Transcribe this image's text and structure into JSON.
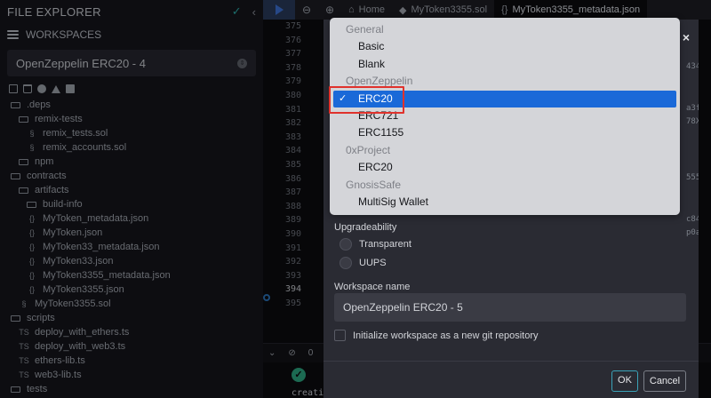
{
  "explorer": {
    "title": "FILE EXPLORER",
    "workspaces_label": "WORKSPACES",
    "workspace_selected": "OpenZeppelin ERC20 - 4",
    "tree": [
      {
        "label": ".deps",
        "kind": "folder",
        "depth": 0
      },
      {
        "label": "remix-tests",
        "kind": "folder",
        "depth": 1
      },
      {
        "label": "remix_tests.sol",
        "kind": "sol",
        "depth": 2
      },
      {
        "label": "remix_accounts.sol",
        "kind": "sol",
        "depth": 2
      },
      {
        "label": "npm",
        "kind": "folder",
        "depth": 1
      },
      {
        "label": "contracts",
        "kind": "folder",
        "depth": 0
      },
      {
        "label": "artifacts",
        "kind": "folder",
        "depth": 1
      },
      {
        "label": "build-info",
        "kind": "folder",
        "depth": 2
      },
      {
        "label": "MyToken_metadata.json",
        "kind": "json",
        "depth": 2
      },
      {
        "label": "MyToken.json",
        "kind": "json",
        "depth": 2
      },
      {
        "label": "MyToken33_metadata.json",
        "kind": "json",
        "depth": 2
      },
      {
        "label": "MyToken33.json",
        "kind": "json",
        "depth": 2
      },
      {
        "label": "MyToken3355_metadata.json",
        "kind": "json",
        "depth": 2
      },
      {
        "label": "MyToken3355.json",
        "kind": "json",
        "depth": 2
      },
      {
        "label": "MyToken3355.sol",
        "kind": "sol",
        "depth": 1
      },
      {
        "label": "scripts",
        "kind": "folder",
        "depth": 0
      },
      {
        "label": "deploy_with_ethers.ts",
        "kind": "ts",
        "depth": 1
      },
      {
        "label": "deploy_with_web3.ts",
        "kind": "ts",
        "depth": 1
      },
      {
        "label": "ethers-lib.ts",
        "kind": "ts",
        "depth": 1
      },
      {
        "label": "web3-lib.ts",
        "kind": "ts",
        "depth": 1
      },
      {
        "label": "tests",
        "kind": "folder",
        "depth": 0
      }
    ]
  },
  "editor": {
    "zoom_out": "⊖",
    "zoom_in": "⊕",
    "tabs": [
      {
        "label": "Home",
        "icon": "home-icon",
        "glyph": "⌂"
      },
      {
        "label": "MyToken3355.sol",
        "icon": "solidity-icon",
        "glyph": "◆"
      },
      {
        "label": "MyToken3355_metadata.json",
        "icon": "json-icon",
        "glyph": "{}"
      }
    ],
    "line_numbers": [
      "375",
      "376",
      "377",
      "378",
      "379",
      "380",
      "381",
      "382",
      "383",
      "384",
      "385",
      "386",
      "387",
      "388",
      "389",
      "390",
      "391",
      "392",
      "393",
      "394",
      "395"
    ],
    "current_line": "394",
    "terminal_text": "creati"
  },
  "modal": {
    "close_glyph": "×",
    "right_peek": [
      "434",
      "",
      "",
      "a3f",
      "78X",
      "",
      "",
      "",
      "555",
      "",
      "",
      "c84",
      "p0a",
      "",
      "",
      "",
      "",
      "",
      "",
      "",
      ""
    ],
    "upgradeability_label": "Upgradeability",
    "upgrade_options": [
      "Transparent",
      "UUPS"
    ],
    "workspace_name_label": "Workspace name",
    "workspace_name_value": "OpenZeppelin ERC20 - 5",
    "init_git_label": "Initialize workspace as a new git repository",
    "ok_label": "OK",
    "cancel_label": "Cancel"
  },
  "template_dropdown": {
    "rows": [
      {
        "type": "group",
        "label": "General"
      },
      {
        "type": "item",
        "label": "Basic"
      },
      {
        "type": "item",
        "label": "Blank"
      },
      {
        "type": "group",
        "label": "OpenZeppelin"
      },
      {
        "type": "item",
        "label": "ERC20",
        "selected": true
      },
      {
        "type": "item",
        "label": "ERC721"
      },
      {
        "type": "item",
        "label": "ERC1155"
      },
      {
        "type": "group",
        "label": "0xProject"
      },
      {
        "type": "item",
        "label": "ERC20"
      },
      {
        "type": "group",
        "label": "GnosisSafe"
      },
      {
        "type": "item",
        "label": "MultiSig Wallet"
      }
    ],
    "check_glyph": "✓"
  },
  "colors": {
    "accent_blue": "#1a69d8",
    "highlight_red": "#e0322c",
    "ok_border": "#3aa3b9",
    "success_green": "#2ba37e"
  }
}
